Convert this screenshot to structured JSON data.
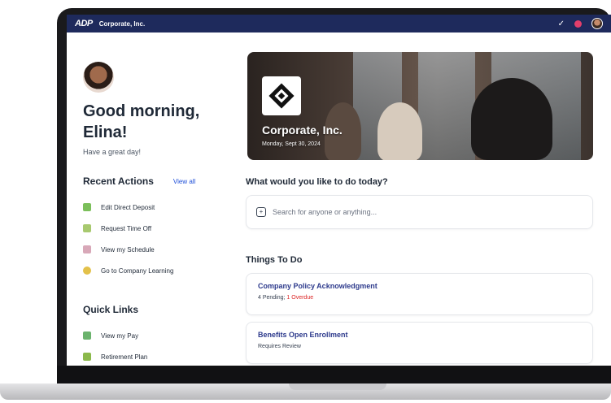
{
  "topbar": {
    "logo": "ADP",
    "company": "Corporate, Inc.",
    "check_icon": "✓",
    "icons": [
      "check-icon",
      "bell-icon",
      "avatar"
    ]
  },
  "user": {
    "greeting_line1": "Good morning,",
    "greeting_line2": "Elina!",
    "subgreeting": "Have a great day!"
  },
  "recent_actions": {
    "title": "Recent Actions",
    "view_all": "View all",
    "items": [
      {
        "label": "Edit Direct Deposit",
        "icon": "money-icon"
      },
      {
        "label": "Request Time Off",
        "icon": "calendar-icon"
      },
      {
        "label": "View my Schedule",
        "icon": "schedule-icon"
      },
      {
        "label": "Go to Company Learning",
        "icon": "learning-icon"
      }
    ]
  },
  "quick_links": {
    "title": "Quick Links",
    "items": [
      {
        "label": "View my Pay",
        "icon": "pay-icon"
      },
      {
        "label": "Retirement Plan",
        "icon": "retire-icon"
      }
    ]
  },
  "hero": {
    "company": "Corporate, Inc.",
    "date": "Monday, Sept 30, 2024"
  },
  "search": {
    "question": "What would you like to do today?",
    "placeholder": "Search for anyone or anything..."
  },
  "things_to_do": {
    "title": "Things To Do",
    "cards": [
      {
        "title": "Company Policy Acknowledgment",
        "status": "4 Pending; ",
        "overdue": "1 Overdue"
      },
      {
        "title": "Benefits Open Enrollment",
        "status": "Requires Review"
      }
    ]
  },
  "colors": {
    "topbar": "#1e2a5c",
    "link": "#1d4ed8",
    "card_title": "#2d3a8c",
    "overdue": "#dc2626"
  }
}
